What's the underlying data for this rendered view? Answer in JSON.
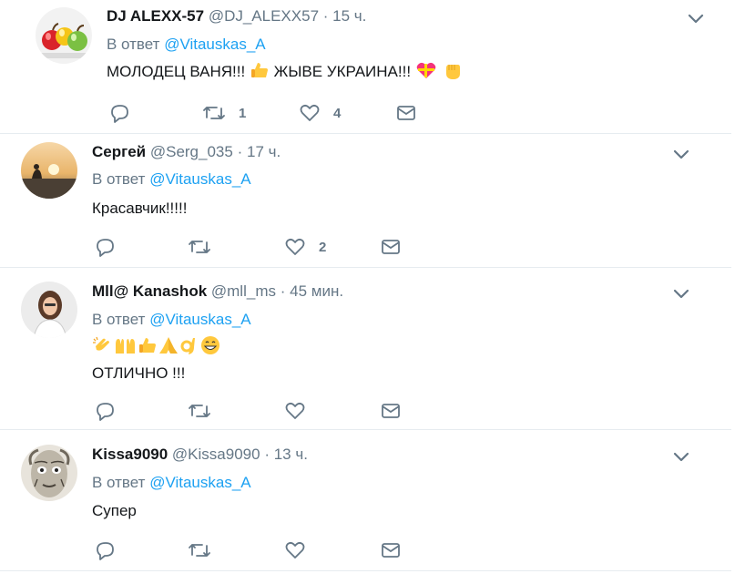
{
  "colors": {
    "accent": "#1da1f2",
    "muted": "#657786",
    "text": "#14171a",
    "divider": "#e6ecf0"
  },
  "tweets": [
    {
      "name": "DJ ALEXX-57",
      "handle": "@DJ_ALEXX57",
      "sep": "·",
      "time": "15 ч.",
      "reply_prefix": "В ответ",
      "reply_to": "@Vitauskas_A",
      "lines": [
        "МОЛОДЕЦ ВАНЯ!!!",
        "ЖЫВЕ УКРАИНА!!!"
      ],
      "emojis": [
        "thumbs-up",
        "gift-heart",
        "raised-fist"
      ],
      "retweets": "1",
      "likes": "4",
      "avatar": "fruit-apples"
    },
    {
      "name": "Сергей",
      "handle": "@Serg_035",
      "sep": "·",
      "time": "17 ч.",
      "reply_prefix": "В ответ",
      "reply_to": "@Vitauskas_A",
      "lines": [
        "Красавчик!!!!!"
      ],
      "retweets": "",
      "likes": "2",
      "avatar": "sunset-person"
    },
    {
      "name": "Mll@ Kanashok",
      "handle": "@mll_ms",
      "sep": "·",
      "time": "45 мин.",
      "reply_prefix": "В ответ",
      "reply_to": "@Vitauskas_A",
      "lines": [
        "ОТЛИЧНО !!!"
      ],
      "emojis": [
        "clapping-hands",
        "raised-hands",
        "thumbs-up",
        "folded-hands",
        "ok-hand",
        "grinning-face"
      ],
      "retweets": "",
      "likes": "",
      "avatar": "woman-portrait"
    },
    {
      "name": "Kissa9090",
      "handle": "@Kissa9090",
      "sep": "·",
      "time": "13 ч.",
      "reply_prefix": "В ответ",
      "reply_to": "@Vitauskas_A",
      "lines": [
        "Супер"
      ],
      "retweets": "",
      "likes": "",
      "avatar": "old-man-sketch"
    }
  ]
}
